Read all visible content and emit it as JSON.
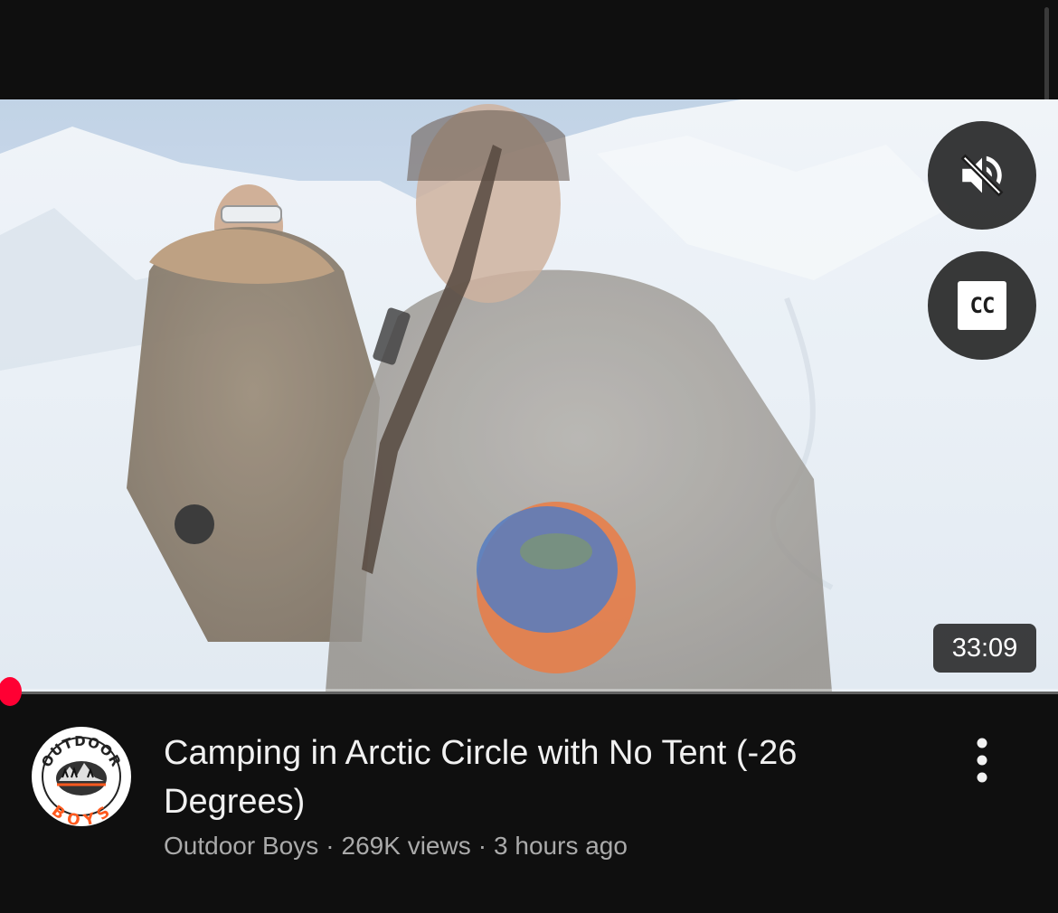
{
  "video": {
    "duration": "33:09",
    "cc_label": "CC",
    "progress_fraction": 0.01,
    "mute_icon": "volume-off-icon",
    "accent_color": "#ff0033"
  },
  "channel": {
    "name": "Outdoor Boys",
    "avatar_text_top": "OUTDOOR",
    "avatar_text_bottom": "BOYS"
  },
  "details": {
    "title": "Camping in Arctic Circle with No Tent (-26 Degrees)",
    "views": "269K views",
    "age": "3 hours ago",
    "separator": "·"
  },
  "actions": {
    "more_icon": "more-vert-icon"
  }
}
